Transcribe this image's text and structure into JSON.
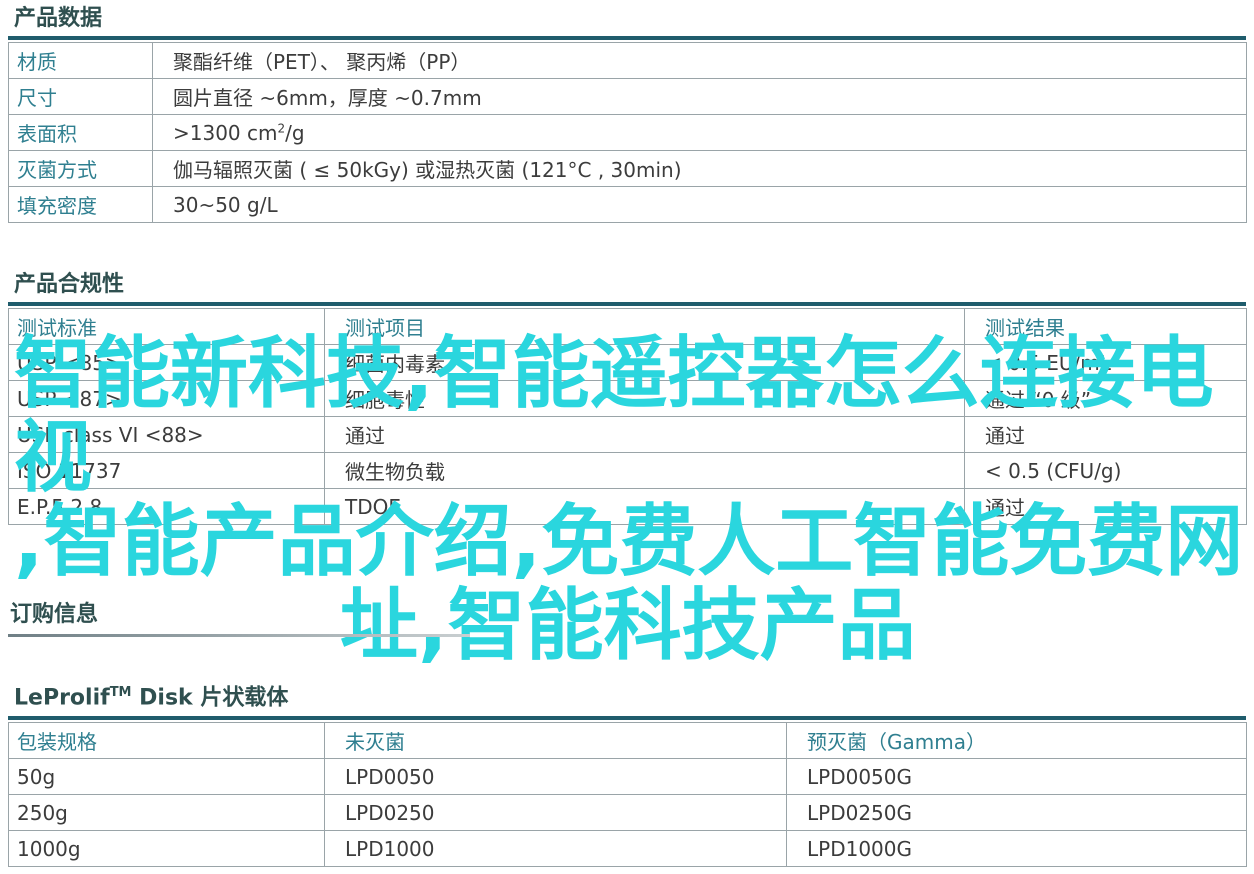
{
  "product_data": {
    "title": "产品数据",
    "rows": [
      {
        "key": "材质",
        "value": "聚酯纤维（PET）、 聚丙烯（PP）"
      },
      {
        "key": "尺寸",
        "value": "圆片直径 ~6mm，厚度 ~0.7mm"
      },
      {
        "key": "表面积",
        "value_pre": ">1300 cm",
        "value_sup": "2",
        "value_post": "/g"
      },
      {
        "key": "灭菌方式",
        "value": "伽马辐照灭菌 ( ≤ 50kGy) 或湿热灭菌 (121°C , 30min)"
      },
      {
        "key": "填充密度",
        "value": "30~50 g/L"
      }
    ]
  },
  "compliance": {
    "title": "产品合规性",
    "headers": [
      "测试标准",
      "测试项目",
      "测试结果"
    ],
    "rows": [
      [
        "USP <85>",
        "细菌内毒素",
        "< 0.5 EU/mL"
      ],
      [
        "USP <87>",
        "细胞毒性",
        "通过 “0 级”"
      ],
      [
        "USP class VI <88>",
        "通过",
        "通过"
      ],
      [
        "ISO 11737",
        "微生物负载",
        "< 0.5 (CFU/g)"
      ],
      [
        "E.P.5.2.8",
        "TDOE",
        "通过"
      ]
    ]
  },
  "order": {
    "title": "订购信息",
    "sub_title_pre": "LeProlif",
    "sub_title_sup": "TM",
    "sub_title_post": " Disk 片状载体",
    "headers": [
      "包装规格",
      "未灭菌",
      "预灭菌（Gamma）"
    ],
    "rows": [
      [
        "50g",
        "LPD0050",
        "LPD0050G"
      ],
      [
        "250g",
        "LPD0250",
        "LPD0250G"
      ],
      [
        "1000g",
        "LPD1000",
        "LPD1000G"
      ]
    ]
  },
  "overlay": {
    "line1": "智能新科技,智能遥控器怎么连接电视",
    "line2": ",智能产品介绍,免费人工智能免费网",
    "line3": "址,智能科技产品"
  },
  "colors": {
    "accent_teal": "#2f7f90",
    "rule": "#1f5c6c",
    "overlay": "#2ad6de"
  }
}
